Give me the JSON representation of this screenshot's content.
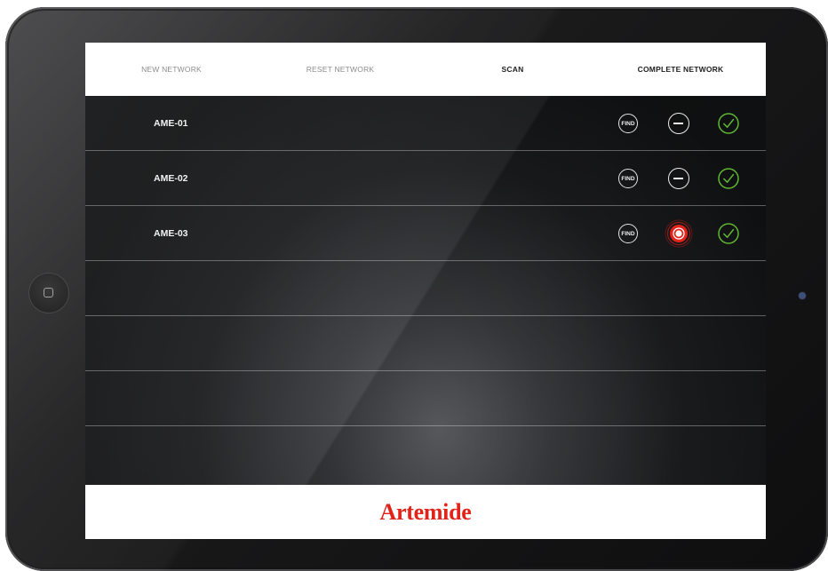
{
  "nav": {
    "new_network": "NEW NETWORK",
    "reset_network": "RESET NETWORK",
    "scan": "SCAN",
    "complete_network": "COMPLETE NETWORK"
  },
  "devices": [
    {
      "name": "AME-01",
      "find_label": "FIND",
      "status": "minus-icon"
    },
    {
      "name": "AME-02",
      "find_label": "FIND",
      "status": "minus-icon"
    },
    {
      "name": "AME-03",
      "find_label": "FIND",
      "status": "pulse-icon"
    }
  ],
  "brand": {
    "logo_text": "Artemide"
  },
  "colors": {
    "brand_red": "#e2231a",
    "check_green": "#5fb832",
    "nav_bg": "#ffffff",
    "screen_bg": "#111213"
  }
}
